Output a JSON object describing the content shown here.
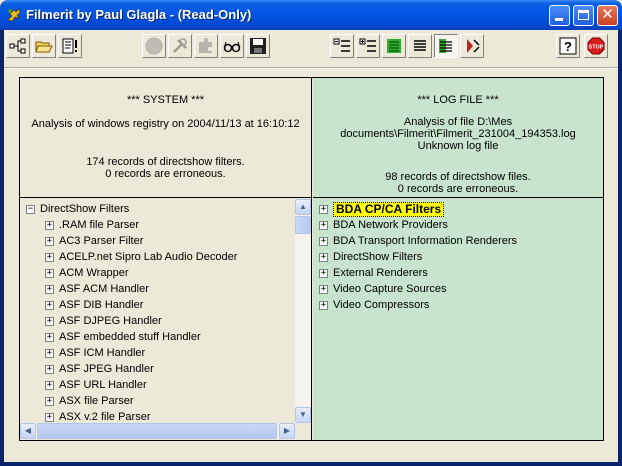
{
  "window": {
    "title": "Filmerit by Paul Glagla - (Read-Only)",
    "icon": "filmerit-app-icon",
    "controls": {
      "minimize": "minimize-icon",
      "maximize": "maximize-icon",
      "close": "close-icon"
    }
  },
  "toolbar": {
    "groups": [
      [
        "tree-hierarchy-icon",
        "open-folder-icon",
        "report-exclamation-icon"
      ],
      [
        "circle-disabled-icon",
        "tools-icon",
        "puzzle-icon",
        "glasses-icon",
        "floppy-save-icon"
      ],
      [
        "collapse-list-icon",
        "expand-list-icon",
        "green-list-icon",
        "black-list-icon",
        "green-black-list-icon",
        "red-tool-icon"
      ],
      [
        "help-icon",
        "stop-icon"
      ]
    ],
    "stop_label": "STOP",
    "help_label": "?"
  },
  "system": {
    "heading": "*** SYSTEM ***",
    "analysis": "Analysis of windows registry on 2004/11/13 at 16:10:12",
    "records": "174 records of directshow filters.",
    "errors": "0 records are erroneous.",
    "tree_root": "DirectShow Filters",
    "tree_items": [
      ".RAM file Parser",
      "AC3 Parser Filter",
      "ACELP.net Sipro Lab Audio Decoder",
      "ACM Wrapper",
      "ASF ACM Handler",
      "ASF DIB Handler",
      "ASF DJPEG Handler",
      "ASF embedded stuff Handler",
      "ASF ICM Handler",
      "ASF JPEG Handler",
      "ASF URL Handler",
      "ASX file Parser",
      "ASX v.2 file Parser"
    ]
  },
  "log": {
    "heading": "*** LOG FILE ***",
    "analysis_line1": "Analysis of file D:\\Mes",
    "analysis_line2": "documents\\Filmerit\\Filmerit_231004_194353.log",
    "analysis_line3": "Unknown log file",
    "records": "98 records of directshow files.",
    "errors": "0 records are erroneous.",
    "tree_items": [
      "BDA CP/CA Filters",
      "BDA Network Providers",
      "BDA Transport Information Renderers",
      "DirectShow Filters",
      "External Renderers",
      "Video Capture Sources",
      "Video Compressors"
    ],
    "selected_index": 0
  },
  "colors": {
    "system_bg": "#ece9d8",
    "log_bg": "#c8e4cc",
    "selection": "#ffff00"
  }
}
